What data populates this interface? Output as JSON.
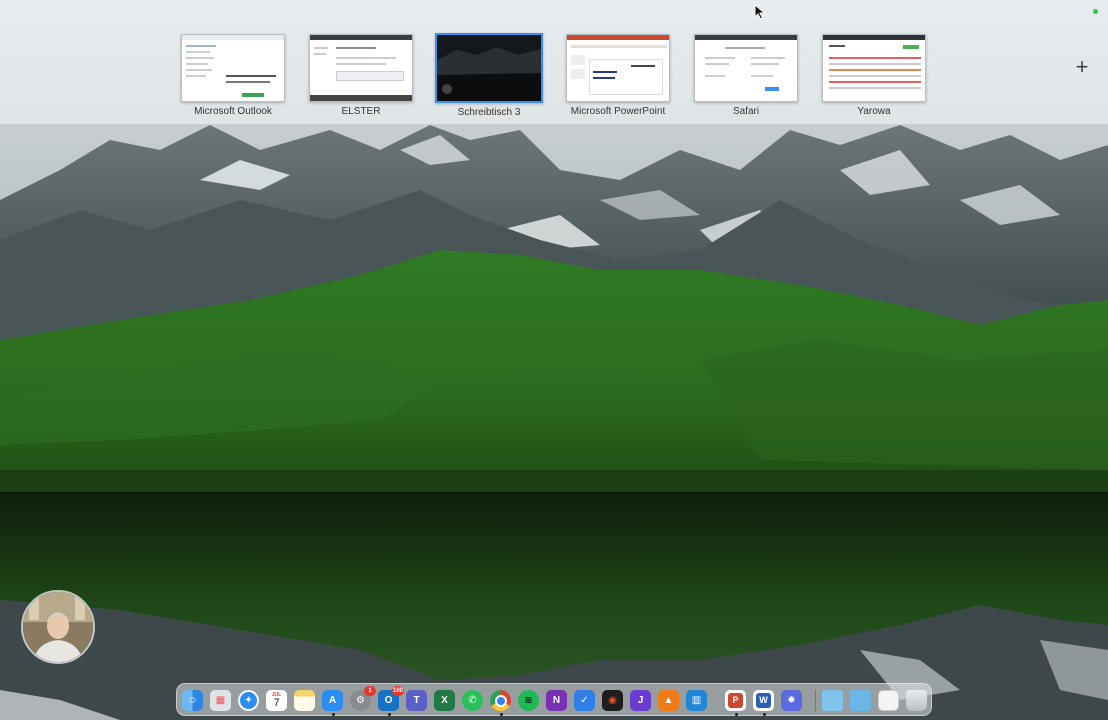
{
  "spaces": [
    {
      "label": "Microsoft Outlook"
    },
    {
      "label": "ELSTER"
    },
    {
      "label": "Schreibtisch 3"
    },
    {
      "label": "Microsoft PowerPoint"
    },
    {
      "label": "Safari"
    },
    {
      "label": "Yarowa"
    }
  ],
  "add_space_label": "+",
  "dock": {
    "calendar_day": "7",
    "calendar_month": "JUL",
    "outlook_badge": "100",
    "settings_badge": "1",
    "apps": [
      "finder",
      "launchpad",
      "safari",
      "calendar",
      "notes",
      "app-store",
      "system-settings",
      "outlook",
      "teams",
      "excel",
      "whatsapp",
      "chrome",
      "spotify",
      "onenote",
      "todo",
      "figma",
      "joplin",
      "overleaf",
      "trello",
      "powerpoint",
      "word",
      "settings-gear",
      "folder",
      "folder",
      "document",
      "trash"
    ]
  },
  "colors": {
    "active_border": "#3a8ef6",
    "badge_red": "#e8362b"
  }
}
